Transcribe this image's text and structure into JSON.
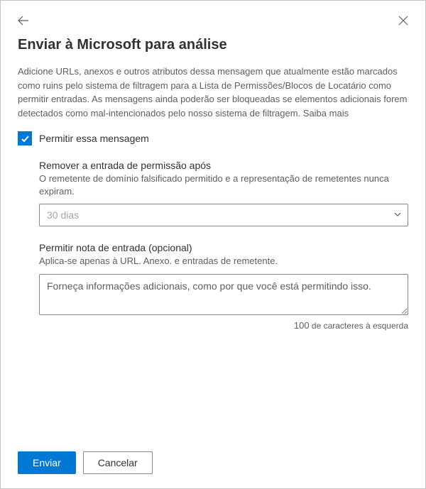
{
  "title": "Enviar à Microsoft para análise",
  "description": "Adicione URLs, anexos e outros atributos dessa mensagem que atualmente estão marcados como ruins pelo sistema de filtragem para a Lista de Permissões/Blocos de Locatário como permitir entradas. As mensagens ainda poderão ser bloqueadas se elementos adicionais forem detectados como mal-intencionados pelo nosso sistema de filtragem. Saiba mais",
  "checkbox": {
    "label": "Permitir essa mensagem",
    "checked": true
  },
  "remove_after": {
    "label": "Remover a entrada de permissão após",
    "sublabel": "O remetente de domínio falsificado permitido e a representação de remetentes nunca expiram.",
    "value": "30 dias"
  },
  "note": {
    "label": "Permitir nota de entrada (opcional)",
    "sublabel": "Aplica-se apenas à URL. Anexo. e entradas de remetente.",
    "placeholder": "Forneça informações adicionais, como por que você está permitindo isso.",
    "char_count": "100",
    "char_count_suffix": "de caracteres à esquerda"
  },
  "footer": {
    "submit": "Enviar",
    "cancel": "Cancelar"
  }
}
